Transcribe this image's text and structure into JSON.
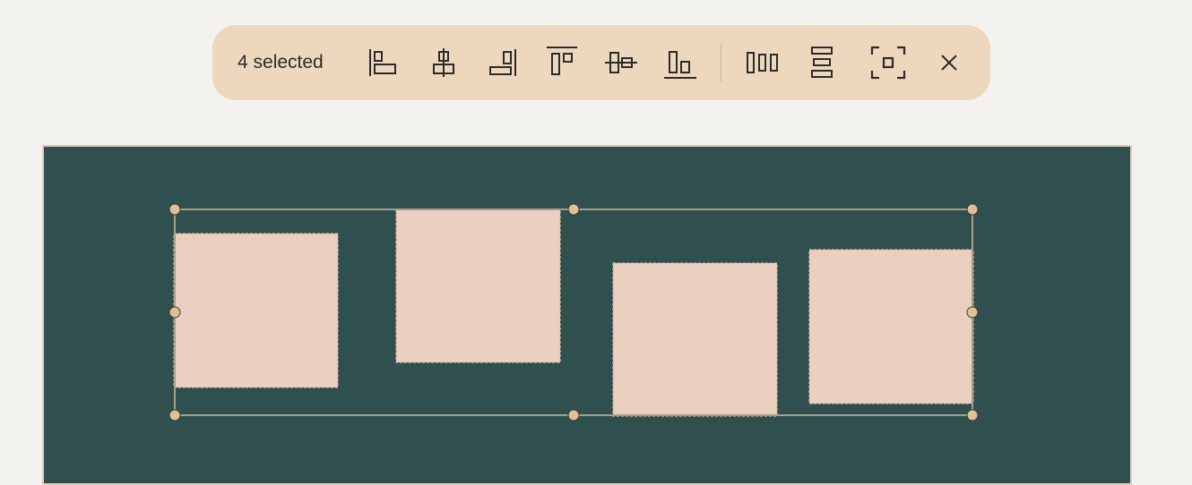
{
  "toolbar": {
    "selection_count_label": "4 selected",
    "background_color": "#eed8bd",
    "buttons": [
      {
        "name": "align-left",
        "icon": "align-left-icon"
      },
      {
        "name": "align-center-horizontal",
        "icon": "align-center-horizontal-icon"
      },
      {
        "name": "align-right",
        "icon": "align-right-icon"
      },
      {
        "name": "align-top",
        "icon": "align-top-icon"
      },
      {
        "name": "align-middle-vertical",
        "icon": "align-middle-vertical-icon"
      },
      {
        "name": "align-bottom",
        "icon": "align-bottom-icon"
      },
      {
        "name": "distribute-horizontal",
        "icon": "distribute-horizontal-icon"
      },
      {
        "name": "distribute-vertical",
        "icon": "distribute-vertical-icon"
      },
      {
        "name": "zoom-to-selection",
        "icon": "focus-frame-icon"
      },
      {
        "name": "close",
        "icon": "close-icon"
      }
    ]
  },
  "canvas": {
    "background_color": "#304f4f",
    "shape_color": "#ebcfc1",
    "handle_color": "#e0c095",
    "selected_shape_count": 4
  }
}
